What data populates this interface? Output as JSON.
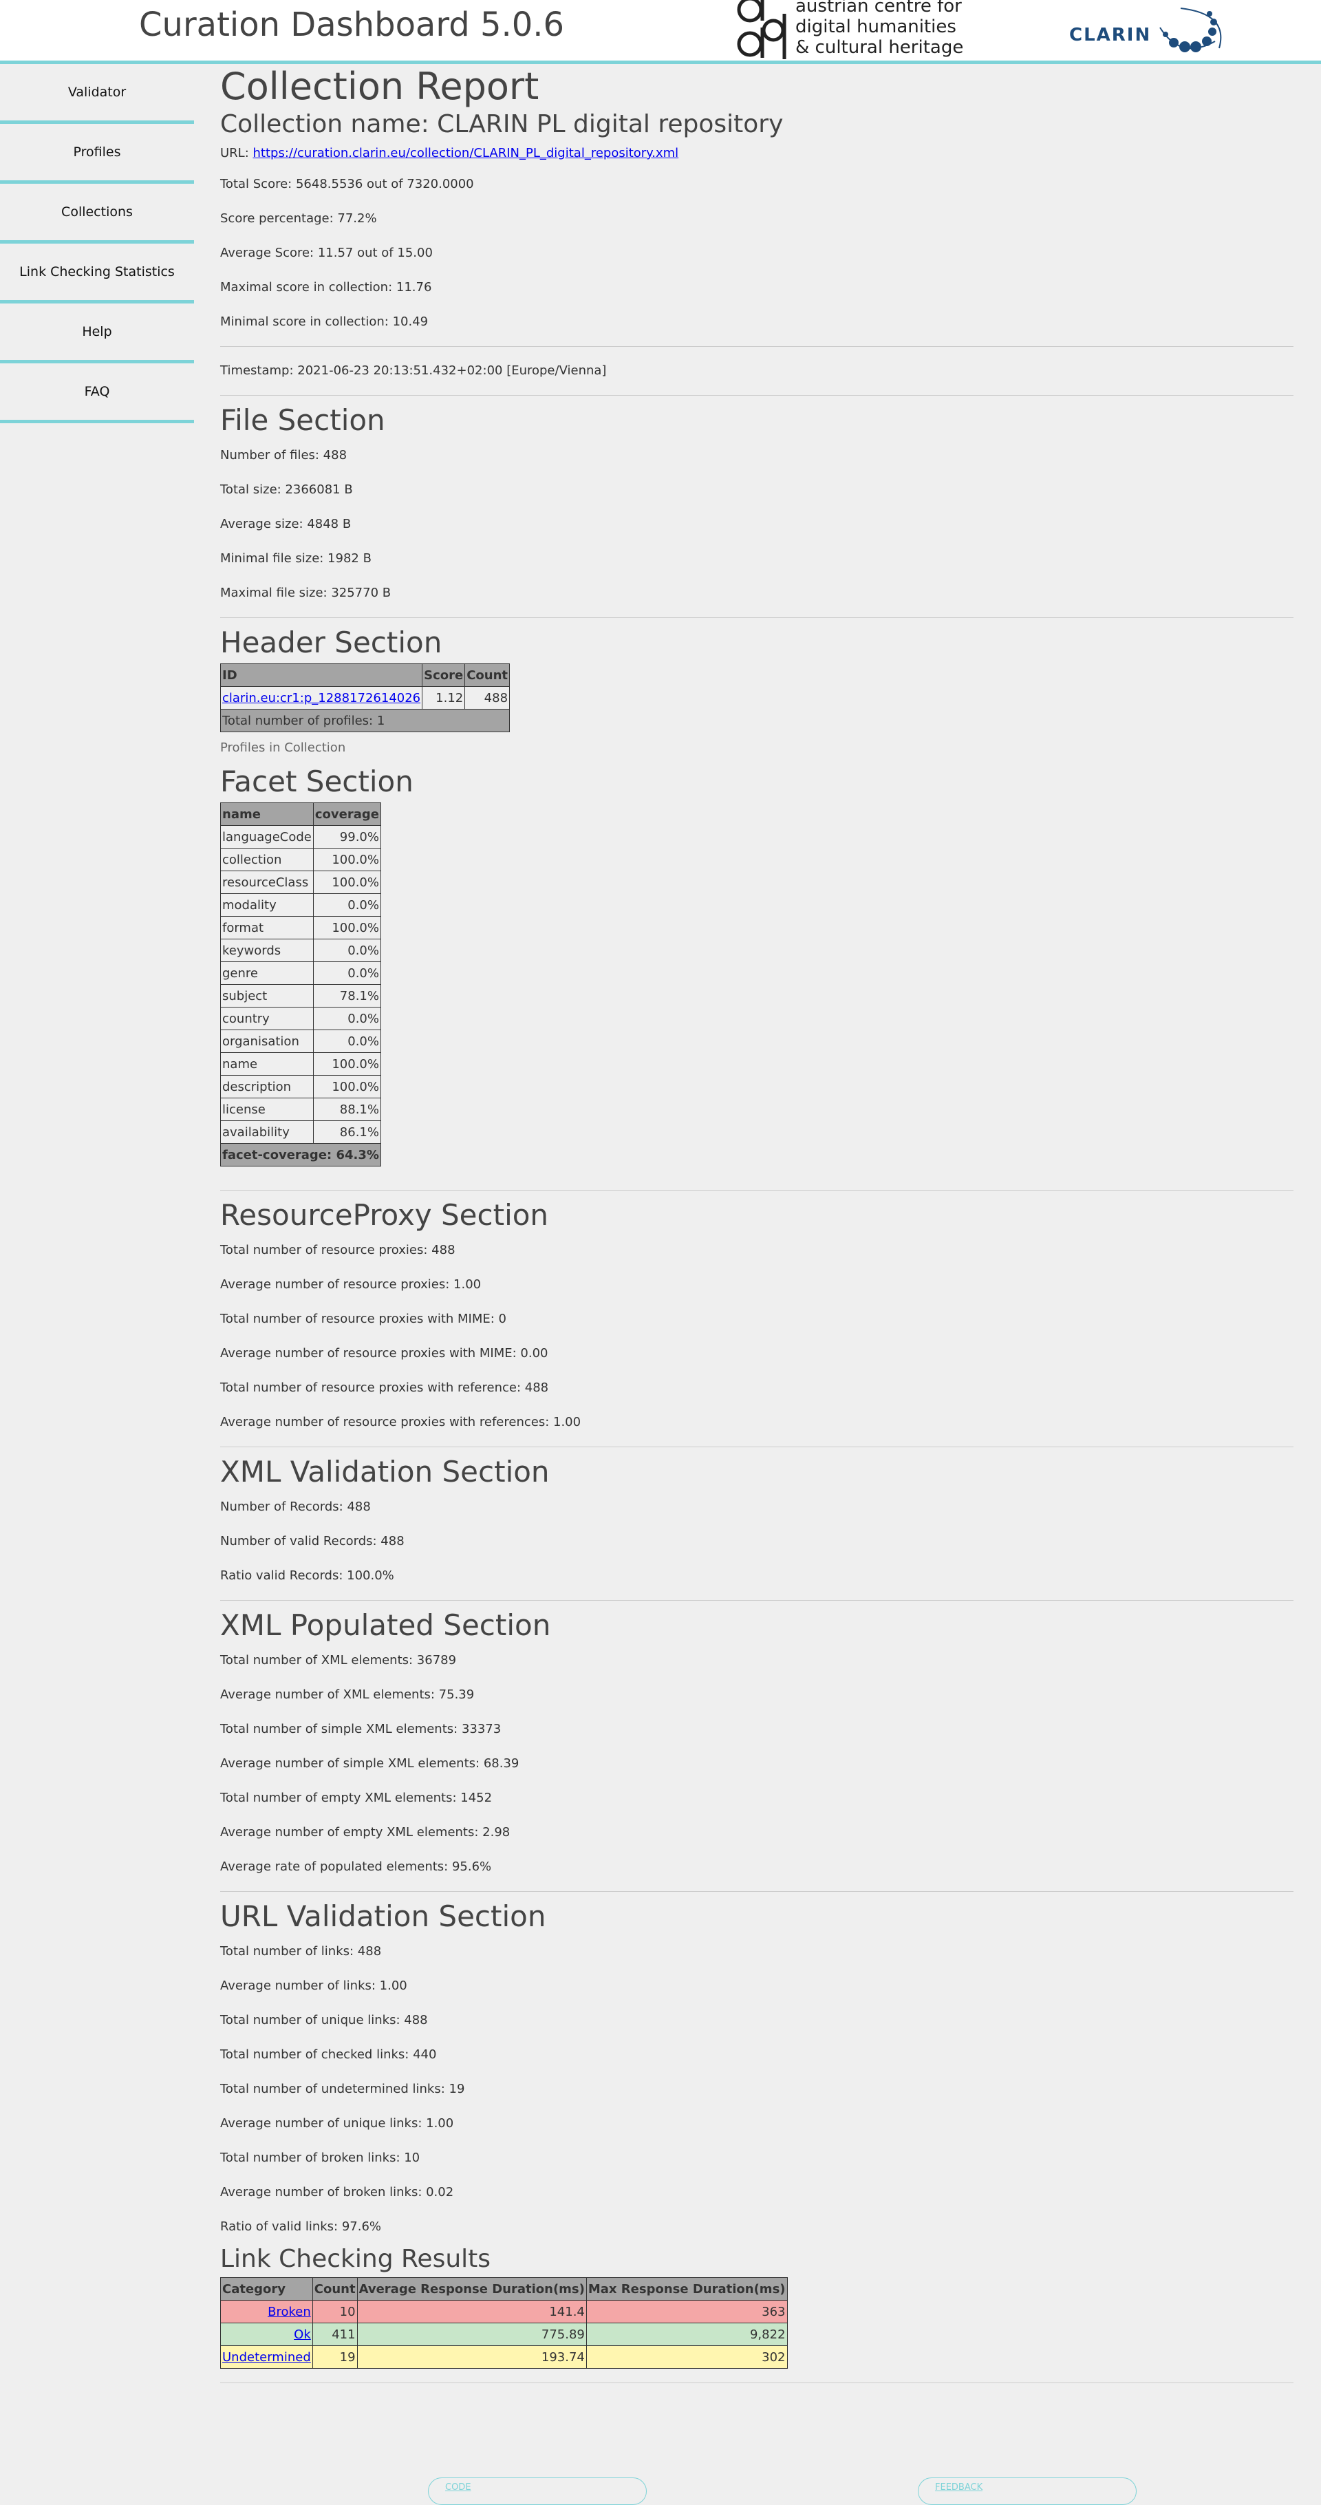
{
  "header": {
    "title": "Curation Dashboard 5.0.6",
    "acdh_lines": [
      "austrian centre for",
      "digital humanities",
      "& cultural heritage"
    ],
    "clarin_label": "CLARIN"
  },
  "sidebar": {
    "items": [
      "Validator",
      "Profiles",
      "Collections",
      "Link Checking Statistics",
      "Help",
      "FAQ"
    ]
  },
  "report": {
    "title": "Collection Report",
    "collection_name": "Collection name: CLARIN PL digital repository",
    "url_prefix": "URL: ",
    "url": "https://curation.clarin.eu/collection/CLARIN_PL_digital_repository.xml",
    "stats": [
      "Total Score: 5648.5536 out of 7320.0000",
      "Score percentage: 77.2%",
      "Average Score: 11.57 out of 15.00",
      "Maximal score in collection: 11.76",
      "Minimal score in collection: 10.49"
    ],
    "timestamp": "Timestamp: 2021-06-23 20:13:51.432+02:00 [Europe/Vienna]"
  },
  "file_section": {
    "title": "File Section",
    "stats": [
      "Number of files: 488",
      "Total size: 2366081 B",
      "Average size: 4848 B",
      "Minimal file size: 1982 B",
      "Maximal file size: 325770 B"
    ]
  },
  "header_section": {
    "title": "Header Section",
    "columns": [
      "ID",
      "Score",
      "Count"
    ],
    "row": {
      "id": "clarin.eu:cr1:p_1288172614026",
      "score": "1.12",
      "count": "488"
    },
    "total": "Total number of profiles: 1",
    "caption": "Profiles in Collection"
  },
  "facet_section": {
    "title": "Facet Section",
    "columns": [
      "name",
      "coverage"
    ],
    "rows": [
      [
        "languageCode",
        "99.0%"
      ],
      [
        "collection",
        "100.0%"
      ],
      [
        "resourceClass",
        "100.0%"
      ],
      [
        "modality",
        "0.0%"
      ],
      [
        "format",
        "100.0%"
      ],
      [
        "keywords",
        "0.0%"
      ],
      [
        "genre",
        "0.0%"
      ],
      [
        "subject",
        "78.1%"
      ],
      [
        "country",
        "0.0%"
      ],
      [
        "organisation",
        "0.0%"
      ],
      [
        "name",
        "100.0%"
      ],
      [
        "description",
        "100.0%"
      ],
      [
        "license",
        "88.1%"
      ],
      [
        "availability",
        "86.1%"
      ]
    ],
    "footer": "facet-coverage: 64.3%"
  },
  "resourceproxy_section": {
    "title": "ResourceProxy Section",
    "stats": [
      "Total number of resource proxies: 488",
      "Average number of resource proxies: 1.00",
      "Total number of resource proxies with MIME: 0",
      "Average number of resource proxies with MIME: 0.00",
      "Total number of resource proxies with reference: 488",
      "Average number of resource proxies with references: 1.00"
    ]
  },
  "xml_validation_section": {
    "title": "XML Validation Section",
    "stats": [
      "Number of Records: 488",
      "Number of valid Records: 488",
      "Ratio valid Records: 100.0%"
    ]
  },
  "xml_populated_section": {
    "title": "XML Populated Section",
    "stats": [
      "Total number of XML elements: 36789",
      "Average number of XML elements: 75.39",
      "Total number of simple XML elements: 33373",
      "Average number of simple XML elements: 68.39",
      "Total number of empty XML elements: 1452",
      "Average number of empty XML elements: 2.98",
      "Average rate of populated elements: 95.6%"
    ]
  },
  "url_validation_section": {
    "title": "URL Validation Section",
    "stats": [
      "Total number of links: 488",
      "Average number of links: 1.00",
      "Total number of unique links: 488",
      "Total number of checked links: 440",
      "Total number of undetermined links: 19",
      "Average number of unique links: 1.00",
      "Total number of broken links: 10",
      "Average number of broken links: 0.02",
      "Ratio of valid links: 97.6%"
    ]
  },
  "link_checking": {
    "title": "Link Checking Results",
    "columns": [
      "Category",
      "Count",
      "Average Response Duration(ms)",
      "Max Response Duration(ms)"
    ],
    "rows": [
      {
        "category": "Broken",
        "count": "10",
        "avg": "141.4",
        "max": "363",
        "color": "#f4a7a7"
      },
      {
        "category": "Ok",
        "count": "411",
        "avg": "775.89",
        "max": "9,822",
        "color": "#c8e6c9"
      },
      {
        "category": "Undetermined",
        "count": "19",
        "avg": "193.74",
        "max": "302",
        "color": "#fff6b0"
      }
    ]
  },
  "footer": {
    "code": "CODE",
    "feedback": "FEEDBACK"
  },
  "colors": {
    "accent": "#7dd3d8",
    "table_header": "#a4a4a4"
  }
}
